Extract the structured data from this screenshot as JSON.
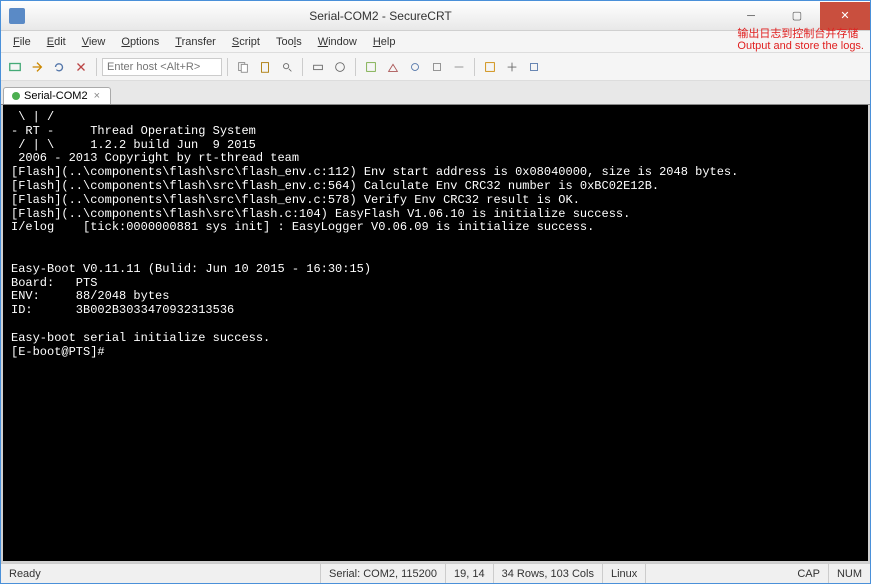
{
  "titlebar": {
    "title": "Serial-COM2 - SecureCRT"
  },
  "menu": [
    "File",
    "Edit",
    "View",
    "Options",
    "Transfer",
    "Script",
    "Tools",
    "Window",
    "Help"
  ],
  "annotation": {
    "zh": "输出日志到控制台并存储",
    "en": "Output and store the logs."
  },
  "toolbar": {
    "host_placeholder": "Enter host <Alt+R>"
  },
  "tab": {
    "label": "Serial-COM2"
  },
  "terminal": {
    "lines": [
      " \\ | /",
      "- RT -     Thread Operating System",
      " / | \\     1.2.2 build Jun  9 2015",
      " 2006 - 2013 Copyright by rt-thread team",
      "[Flash](..\\components\\flash\\src\\flash_env.c:112) Env start address is 0x08040000, size is 2048 bytes.",
      "[Flash](..\\components\\flash\\src\\flash_env.c:564) Calculate Env CRC32 number is 0xBC02E12B.",
      "[Flash](..\\components\\flash\\src\\flash_env.c:578) Verify Env CRC32 result is OK.",
      "[Flash](..\\components\\flash\\src\\flash.c:104) EasyFlash V1.06.10 is initialize success.",
      "I/elog    [tick:0000000881 sys init] : EasyLogger V0.06.09 is initialize success.",
      "",
      "",
      "Easy-Boot V0.11.11 (Bulid: Jun 10 2015 - 16:30:15)",
      "Board:   PTS",
      "ENV:     88/2048 bytes",
      "ID:      3B002B3033470932313536",
      "",
      "Easy-boot serial initialize success.",
      "[E-boot@PTS]#"
    ]
  },
  "status": {
    "ready": "Ready",
    "serial": "Serial: COM2, 115200",
    "pos": "19,  14",
    "size": "34 Rows, 103 Cols",
    "os": "Linux",
    "cap": "CAP",
    "num": "NUM"
  }
}
